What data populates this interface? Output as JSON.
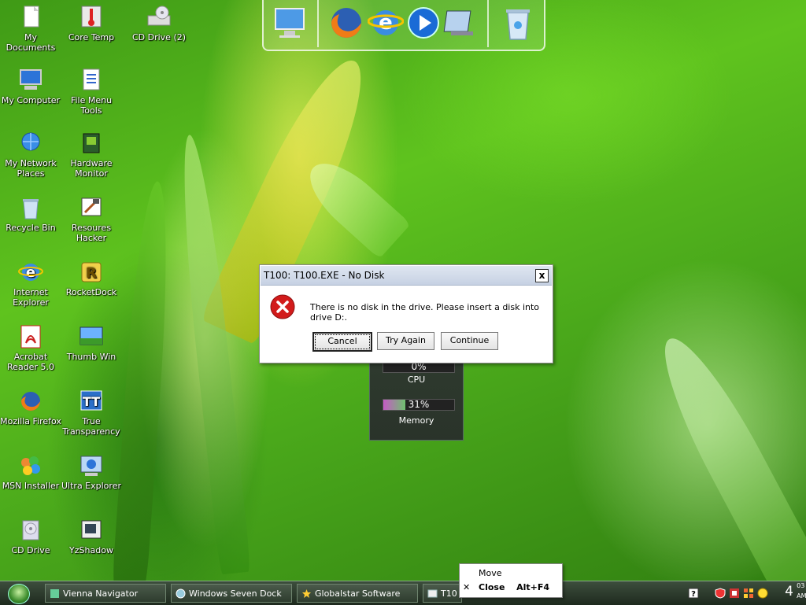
{
  "desktop_icons": [
    {
      "label": "My Documents",
      "icon": "documents-icon"
    },
    {
      "label": "Core Temp",
      "icon": "thermometer-icon"
    },
    {
      "label": "CD Drive (2)",
      "icon": "cd-drive-icon"
    },
    {
      "label": "My Computer",
      "icon": "computer-icon"
    },
    {
      "label": "File Menu Tools",
      "icon": "file-tools-icon"
    },
    {
      "label": "My Network Places",
      "icon": "network-icon"
    },
    {
      "label": "Hardware Monitor",
      "icon": "chip-icon"
    },
    {
      "label": "Recycle Bin",
      "icon": "recycle-bin-icon"
    },
    {
      "label": "Resoures Hacker",
      "icon": "hacker-icon"
    },
    {
      "label": "Internet Explorer",
      "icon": "ie-icon"
    },
    {
      "label": "RocketDock",
      "icon": "rocketdock-icon"
    },
    {
      "label": "Acrobat Reader 5.0",
      "icon": "acrobat-icon"
    },
    {
      "label": "Thumb Win",
      "icon": "thumb-icon"
    },
    {
      "label": "Mozilla Firefox",
      "icon": "firefox-icon"
    },
    {
      "label": "True Transparency",
      "icon": "transparency-icon"
    },
    {
      "label": "MSN Installer",
      "icon": "msn-icon"
    },
    {
      "label": "Ultra Explorer",
      "icon": "explorer-icon"
    },
    {
      "label": "CD Drive",
      "icon": "cd-drive-icon"
    },
    {
      "label": "YzShadow",
      "icon": "shadow-icon"
    }
  ],
  "dock": {
    "items": [
      "monitor-icon",
      "firefox-icon",
      "ie-icon",
      "media-player-icon",
      "control-panel-icon",
      "recycle-bin-icon"
    ]
  },
  "dialog": {
    "title": "T100: T100.EXE - No Disk",
    "close_label": "x",
    "message": "There is no disk in the drive. Please insert a disk into drive D:.",
    "buttons": {
      "cancel": "Cancel",
      "try_again": "Try Again",
      "continue": "Continue"
    }
  },
  "gadget": {
    "cpu_value": "0%",
    "cpu_label": "CPU",
    "memory_value": "31%",
    "memory_label": "Memory",
    "memory_fraction": 0.31
  },
  "taskbar": {
    "tasks": [
      {
        "label": "Vienna Navigator"
      },
      {
        "label": "Windows Seven Dock"
      },
      {
        "label": "Globalstar Software"
      },
      {
        "label": "T10"
      }
    ],
    "clock": {
      "time": "4",
      "minutes": "03",
      "ampm": "AM"
    }
  },
  "context_menu": {
    "move": "Move",
    "close": "Close",
    "close_shortcut": "Alt+F4"
  }
}
